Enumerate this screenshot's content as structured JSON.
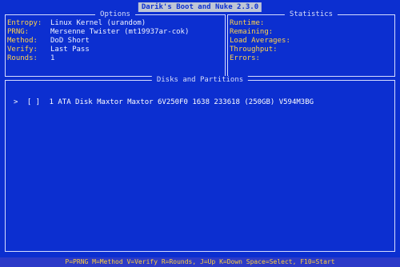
{
  "title": "Darik's Boot and Nuke 2.3.0",
  "options": {
    "heading": "Options",
    "rows": [
      {
        "label": "Entropy:",
        "value": "Linux Kernel (urandom)"
      },
      {
        "label": "PRNG:",
        "value": "Mersenne Twister (mt19937ar-cok)"
      },
      {
        "label": "Method:",
        "value": "DoD Short"
      },
      {
        "label": "Verify:",
        "value": "Last Pass"
      },
      {
        "label": "Rounds:",
        "value": "1"
      }
    ]
  },
  "statistics": {
    "heading": "Statistics",
    "rows": [
      {
        "label": "Runtime:"
      },
      {
        "label": "Remaining:"
      },
      {
        "label": "Load Averages:"
      },
      {
        "label": "Throughput:"
      },
      {
        "label": "Errors:"
      }
    ]
  },
  "disks": {
    "heading": "Disks and Partitions",
    "items": [
      {
        "cursor": ">",
        "selected": "[ ]",
        "description": "1 ATA Disk Maxtor Maxtor 6V250F0 1638 233618 (250GB) V594M3BG"
      }
    ]
  },
  "footer": {
    "hint": "P=PRNG M=Method V=Verify R=Rounds, J=Up K=Down Space=Select, F10=Start"
  }
}
